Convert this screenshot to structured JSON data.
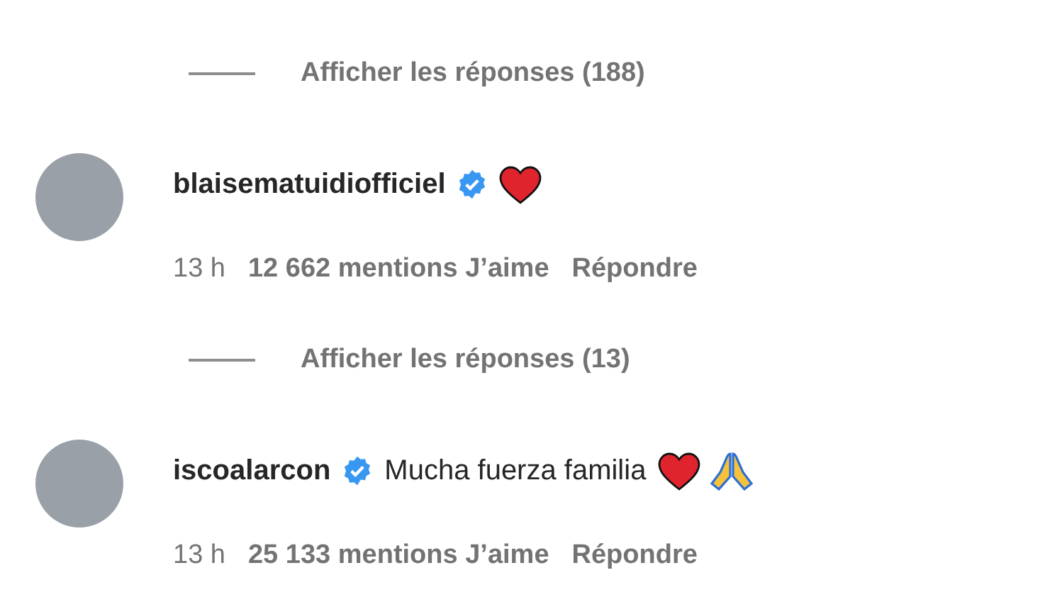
{
  "items": [
    {
      "kind": "toggle",
      "label": "Afficher les réponses (188)"
    },
    {
      "kind": "comment",
      "username": "blaisematuidiofficiel",
      "verified": true,
      "icons": [
        {
          "kind": "heart"
        }
      ],
      "time": "13 h",
      "likes": "12 662 mentions J’aime",
      "reply": "Répondre"
    },
    {
      "kind": "toggle",
      "label": "Afficher les réponses (13)"
    },
    {
      "kind": "comment",
      "username": "iscoalarcon",
      "verified": true,
      "text": "Mucha fuerza familia",
      "icons": [
        {
          "kind": "heart"
        },
        {
          "kind": "praying-hands"
        }
      ],
      "time": "13 h",
      "likes": "25 133 mentions J’aime",
      "reply": "Répondre"
    }
  ]
}
